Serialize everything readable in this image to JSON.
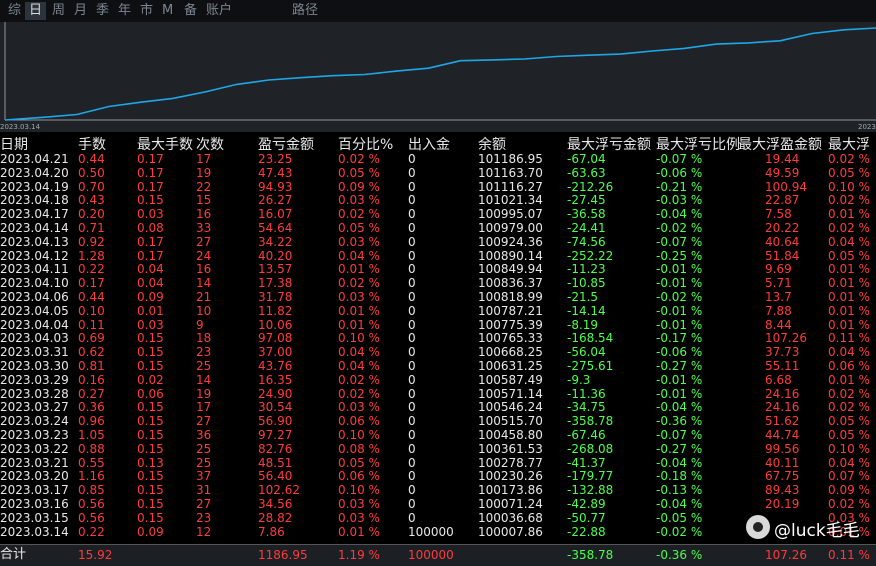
{
  "tabs": [
    "综",
    "日",
    "周",
    "月",
    "季",
    "年",
    "市",
    "M",
    "备",
    "账户",
    "路径"
  ],
  "active_tab": "日",
  "chart_data": {
    "type": "line",
    "x": [
      "2023.03.14",
      "2023.03.15",
      "2023.03.16",
      "2023.03.17",
      "2023.03.20",
      "2023.03.21",
      "2023.03.22",
      "2023.03.23",
      "2023.03.24",
      "2023.03.27",
      "2023.03.28",
      "2023.03.29",
      "2023.03.30",
      "2023.03.31",
      "2023.04.03",
      "2023.04.04",
      "2023.04.05",
      "2023.04.06",
      "2023.04.10",
      "2023.04.11",
      "2023.04.12",
      "2023.04.13",
      "2023.04.14",
      "2023.04.17",
      "2023.04.18",
      "2023.04.19",
      "2023.04.20",
      "2023.04.21"
    ],
    "series": [
      {
        "values": [
          100007.86,
          100036.68,
          100071.24,
          100173.86,
          100230.26,
          100278.77,
          100361.53,
          100458.8,
          100515.7,
          100546.24,
          100571.14,
          100587.49,
          100631.25,
          100668.25,
          100765.33,
          100775.39,
          100787.21,
          100818.99,
          100836.37,
          100849.94,
          100890.14,
          100924.36,
          100979.0,
          100995.07,
          101021.34,
          101116.27,
          101163.7,
          101186.95
        ]
      }
    ],
    "xtick_labels": [
      "2023.03.14",
      "2023"
    ],
    "color": "#1ea7e8"
  },
  "headers": [
    "日期",
    "手数",
    "最大手数",
    "次数",
    "盈亏金额",
    "百分比%",
    "出入金",
    "余额",
    "最大浮亏金额",
    "最大浮亏比例",
    "最大浮盈金额",
    "最大浮"
  ],
  "rows": [
    [
      "2023.04.21",
      "0.44",
      "0.17",
      "17",
      "23.25",
      "0.02 %",
      "0",
      "101186.95",
      "-67.04",
      "-0.07 %",
      "19.44",
      "0.02 %"
    ],
    [
      "2023.04.20",
      "0.50",
      "0.17",
      "19",
      "47.43",
      "0.05 %",
      "0",
      "101163.70",
      "-63.63",
      "-0.06 %",
      "49.59",
      "0.05 %"
    ],
    [
      "2023.04.19",
      "0.70",
      "0.17",
      "22",
      "94.93",
      "0.09 %",
      "0",
      "101116.27",
      "-212.26",
      "-0.21 %",
      "100.94",
      "0.10 %"
    ],
    [
      "2023.04.18",
      "0.43",
      "0.15",
      "15",
      "26.27",
      "0.03 %",
      "0",
      "101021.34",
      "-27.45",
      "-0.03 %",
      "22.87",
      "0.02 %"
    ],
    [
      "2023.04.17",
      "0.20",
      "0.03",
      "16",
      "16.07",
      "0.02 %",
      "0",
      "100995.07",
      "-36.58",
      "-0.04 %",
      "7.58",
      "0.01 %"
    ],
    [
      "2023.04.14",
      "0.71",
      "0.08",
      "33",
      "54.64",
      "0.05 %",
      "0",
      "100979.00",
      "-24.41",
      "-0.02 %",
      "20.22",
      "0.02 %"
    ],
    [
      "2023.04.13",
      "0.92",
      "0.17",
      "27",
      "34.22",
      "0.03 %",
      "0",
      "100924.36",
      "-74.56",
      "-0.07 %",
      "40.64",
      "0.04 %"
    ],
    [
      "2023.04.12",
      "1.28",
      "0.17",
      "24",
      "40.20",
      "0.04 %",
      "0",
      "100890.14",
      "-252.22",
      "-0.25 %",
      "51.84",
      "0.05 %"
    ],
    [
      "2023.04.11",
      "0.22",
      "0.04",
      "16",
      "13.57",
      "0.01 %",
      "0",
      "100849.94",
      "-11.23",
      "-0.01 %",
      "9.69",
      "0.01 %"
    ],
    [
      "2023.04.10",
      "0.17",
      "0.04",
      "14",
      "17.38",
      "0.02 %",
      "0",
      "100836.37",
      "-10.85",
      "-0.01 %",
      "5.71",
      "0.01 %"
    ],
    [
      "2023.04.06",
      "0.44",
      "0.09",
      "21",
      "31.78",
      "0.03 %",
      "0",
      "100818.99",
      "-21.5",
      "-0.02 %",
      "13.7",
      "0.01 %"
    ],
    [
      "2023.04.05",
      "0.10",
      "0.01",
      "10",
      "11.82",
      "0.01 %",
      "0",
      "100787.21",
      "-14.14",
      "-0.01 %",
      "7.88",
      "0.01 %"
    ],
    [
      "2023.04.04",
      "0.11",
      "0.03",
      "9",
      "10.06",
      "0.01 %",
      "0",
      "100775.39",
      "-8.19",
      "-0.01 %",
      "8.44",
      "0.01 %"
    ],
    [
      "2023.04.03",
      "0.69",
      "0.15",
      "18",
      "97.08",
      "0.10 %",
      "0",
      "100765.33",
      "-168.54",
      "-0.17 %",
      "107.26",
      "0.11 %"
    ],
    [
      "2023.03.31",
      "0.62",
      "0.15",
      "23",
      "37.00",
      "0.04 %",
      "0",
      "100668.25",
      "-56.04",
      "-0.06 %",
      "37.73",
      "0.04 %"
    ],
    [
      "2023.03.30",
      "0.81",
      "0.15",
      "25",
      "43.76",
      "0.04 %",
      "0",
      "100631.25",
      "-275.61",
      "-0.27 %",
      "55.11",
      "0.06 %"
    ],
    [
      "2023.03.29",
      "0.16",
      "0.02",
      "14",
      "16.35",
      "0.02 %",
      "0",
      "100587.49",
      "-9.3",
      "-0.01 %",
      "6.68",
      "0.01 %"
    ],
    [
      "2023.03.28",
      "0.27",
      "0.06",
      "19",
      "24.90",
      "0.02 %",
      "0",
      "100571.14",
      "-11.36",
      "-0.01 %",
      "24.16",
      "0.02 %"
    ],
    [
      "2023.03.27",
      "0.36",
      "0.15",
      "17",
      "30.54",
      "0.03 %",
      "0",
      "100546.24",
      "-34.75",
      "-0.04 %",
      "24.16",
      "0.02 %"
    ],
    [
      "2023.03.24",
      "0.96",
      "0.15",
      "27",
      "56.90",
      "0.06 %",
      "0",
      "100515.70",
      "-358.78",
      "-0.36 %",
      "51.62",
      "0.05 %"
    ],
    [
      "2023.03.23",
      "1.05",
      "0.15",
      "36",
      "97.27",
      "0.10 %",
      "0",
      "100458.80",
      "-67.46",
      "-0.07 %",
      "44.74",
      "0.05 %"
    ],
    [
      "2023.03.22",
      "0.88",
      "0.15",
      "25",
      "82.76",
      "0.08 %",
      "0",
      "100361.53",
      "-268.08",
      "-0.27 %",
      "99.56",
      "0.10 %"
    ],
    [
      "2023.03.21",
      "0.55",
      "0.13",
      "25",
      "48.51",
      "0.05 %",
      "0",
      "100278.77",
      "-41.37",
      "-0.04 %",
      "40.11",
      "0.04 %"
    ],
    [
      "2023.03.20",
      "1.16",
      "0.15",
      "37",
      "56.40",
      "0.06 %",
      "0",
      "100230.26",
      "-179.77",
      "-0.18 %",
      "67.75",
      "0.07 %"
    ],
    [
      "2023.03.17",
      "0.85",
      "0.15",
      "31",
      "102.62",
      "0.10 %",
      "0",
      "100173.86",
      "-132.88",
      "-0.13 %",
      "89.43",
      "0.09 %"
    ],
    [
      "2023.03.16",
      "0.56",
      "0.15",
      "27",
      "34.56",
      "0.03 %",
      "0",
      "100071.24",
      "-42.89",
      "-0.04 %",
      "20.19",
      "0.02 %"
    ],
    [
      "2023.03.15",
      "0.56",
      "0.15",
      "23",
      "28.82",
      "0.03 %",
      "0",
      "100036.68",
      "-50.77",
      "-0.05 %",
      "",
      "0.03 %"
    ],
    [
      "2023.03.14",
      "0.22",
      "0.09",
      "12",
      "7.86",
      "0.01 %",
      "100000",
      "100007.86",
      "-22.88",
      "-0.02 %",
      "",
      "0.01 %"
    ]
  ],
  "total": {
    "label": "合计",
    "lots": "15.92",
    "pnl": "1186.95",
    "pct": "1.19 %",
    "deposit": "100000",
    "maxdd": "-358.78",
    "maxdd_pct": "-0.36 %",
    "maxfu": "107.26",
    "maxfu_pct": "0.11 %"
  },
  "watermark": "@luck毛毛",
  "colors": {
    "profit": "#ff3b3b",
    "loss": "#4cff4c",
    "line": "#1ea7e8",
    "chart_bg": "#1f2328"
  }
}
